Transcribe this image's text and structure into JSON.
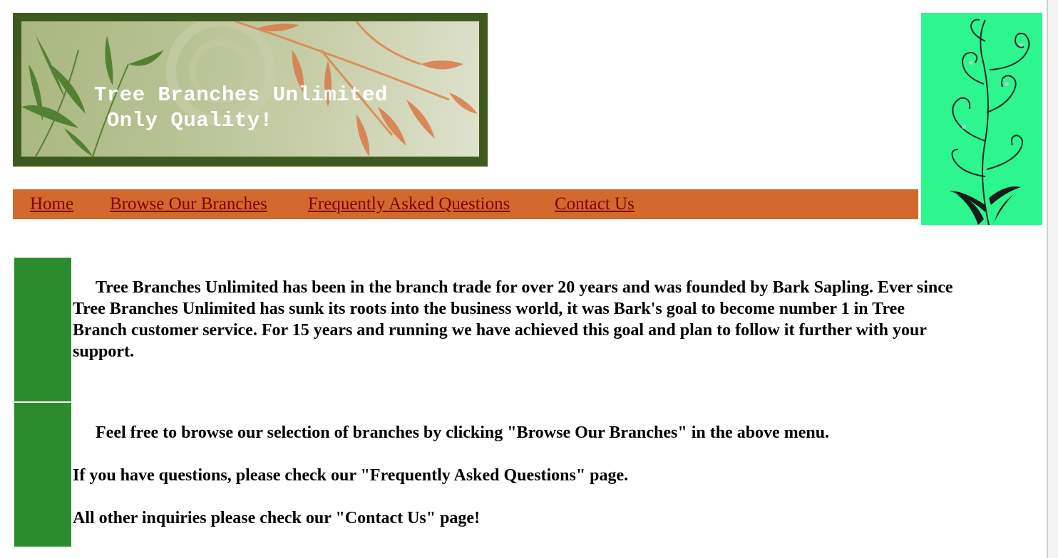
{
  "banner": {
    "line1": "Tree Branches Unlimited",
    "line2": "Only Quality!"
  },
  "nav": {
    "items": [
      {
        "label": "Home"
      },
      {
        "label": "Browse Our Branches"
      },
      {
        "label": "Frequently Asked Questions"
      },
      {
        "label": "Contact Us"
      }
    ]
  },
  "content": {
    "about": "Tree Branches Unlimited has been in the branch trade for over 20 years and was founded by Bark Sapling. Ever since Tree Branches Unlimited has sunk its roots into the business world, it was Bark's goal to become number 1 in Tree Branch customer service. For 15 years and running we have achieved this goal and plan to follow it further with your support.",
    "browse": "Feel free to browse our selection of branches by clicking \"Browse Our Branches\" in the above menu.",
    "questions": "If you have questions, please check our \"Frequently Asked Questions\" page.",
    "inquiries": "All other inquiries please check our \"Contact Us\" page!"
  },
  "colors": {
    "nav_background": "#d26a2d",
    "link": "#800000",
    "green_block": "#2c8b2d",
    "side_art_background": "#2cf68d",
    "banner_frame": "#3f5a21"
  }
}
